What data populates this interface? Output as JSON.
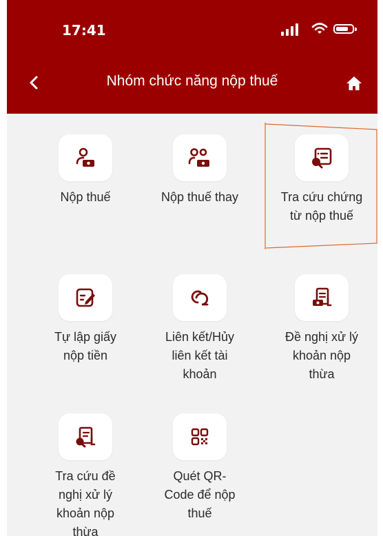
{
  "status_bar": {
    "time": "17:41"
  },
  "header": {
    "title": "Nhóm chức năng nộp thuế"
  },
  "tiles": [
    {
      "label": "Nộp thuế",
      "icon": "person-cash-icon"
    },
    {
      "label": "Nộp thuế thay",
      "icon": "people-cash-icon"
    },
    {
      "label": "Tra cứu chứng\ntừ nộp thuế",
      "icon": "document-search-icon"
    },
    {
      "label": "Tự lập giấy\nnộp tiền",
      "icon": "edit-document-icon"
    },
    {
      "label": "Liên kết/Hủy\nliên kết tài\nkhoản",
      "icon": "link-icon"
    },
    {
      "label": "Đề nghị xử lý\nkhoản nộp\nthừa",
      "icon": "document-cash-icon"
    },
    {
      "label": "Tra cứu đề\nnghị xử lý\nkhoản nộp\nthừa",
      "icon": "document-search-icon"
    },
    {
      "label": "Quét QR-\nCode để nộp\nthuế",
      "icon": "qr-code-icon"
    }
  ],
  "colors": {
    "header": "#9b0000",
    "icon": "#7a0c0c",
    "highlight": "#e06a2b",
    "background": "#f2f2f2"
  }
}
